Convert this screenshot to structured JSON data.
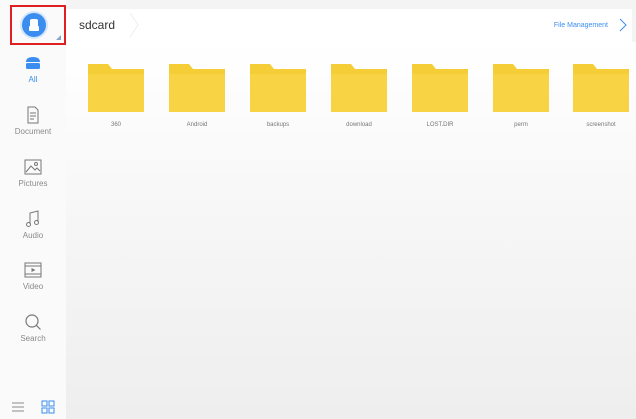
{
  "sidebar": {
    "storage_icon": "storage-icon",
    "items": [
      {
        "key": "all",
        "label": "All",
        "icon": "all-files-icon"
      },
      {
        "key": "document",
        "label": "Document",
        "icon": "document-icon"
      },
      {
        "key": "pictures",
        "label": "Pictures",
        "icon": "picture-icon"
      },
      {
        "key": "audio",
        "label": "Audio",
        "icon": "music-note-icon"
      },
      {
        "key": "video",
        "label": "Video",
        "icon": "video-icon"
      },
      {
        "key": "search",
        "label": "Search",
        "icon": "search-icon"
      }
    ],
    "view_toggles": [
      "list-view-icon",
      "grid-view-icon"
    ]
  },
  "header": {
    "breadcrumb": "sdcard",
    "link": "File Management"
  },
  "folders": [
    {
      "name": "360"
    },
    {
      "name": "Android"
    },
    {
      "name": "backups"
    },
    {
      "name": "download"
    },
    {
      "name": "LOST.DIR"
    },
    {
      "name": "perm"
    },
    {
      "name": "screenshot"
    }
  ],
  "colors": {
    "accent": "#3b8ef0",
    "folder": "#f5cd37",
    "highlight_border": "#e02020"
  }
}
